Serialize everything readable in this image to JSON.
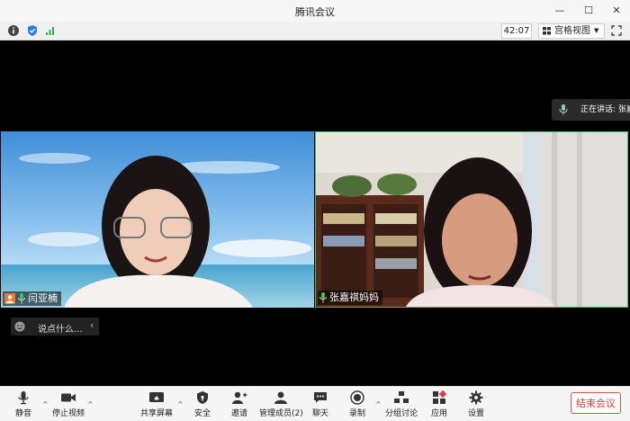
{
  "window": {
    "title": "腾讯会议",
    "minimize": "—",
    "maximize": "☐",
    "close": "✕"
  },
  "infobar": {
    "timer": "42:07",
    "view_mode": "宫格视图"
  },
  "speaking": {
    "text": "正在讲话: 张嘉"
  },
  "participants": [
    {
      "name": "闫亚楠"
    },
    {
      "name": "张嘉祺妈妈"
    }
  ],
  "chat": {
    "placeholder": "说点什么..."
  },
  "toolbar": {
    "mute": "静音",
    "stop_video": "停止视频",
    "share_screen": "共享屏幕",
    "security": "安全",
    "invite": "邀请",
    "manage_members": "管理成员(2)",
    "chat": "聊天",
    "record": "录制",
    "breakout": "分组讨论",
    "apps": "应用",
    "settings": "设置",
    "end_meeting": "结束会议"
  },
  "colors": {
    "accent_green": "#3fbf5f",
    "end_red": "#e03c3c",
    "info_blue": "#2a7de1"
  }
}
